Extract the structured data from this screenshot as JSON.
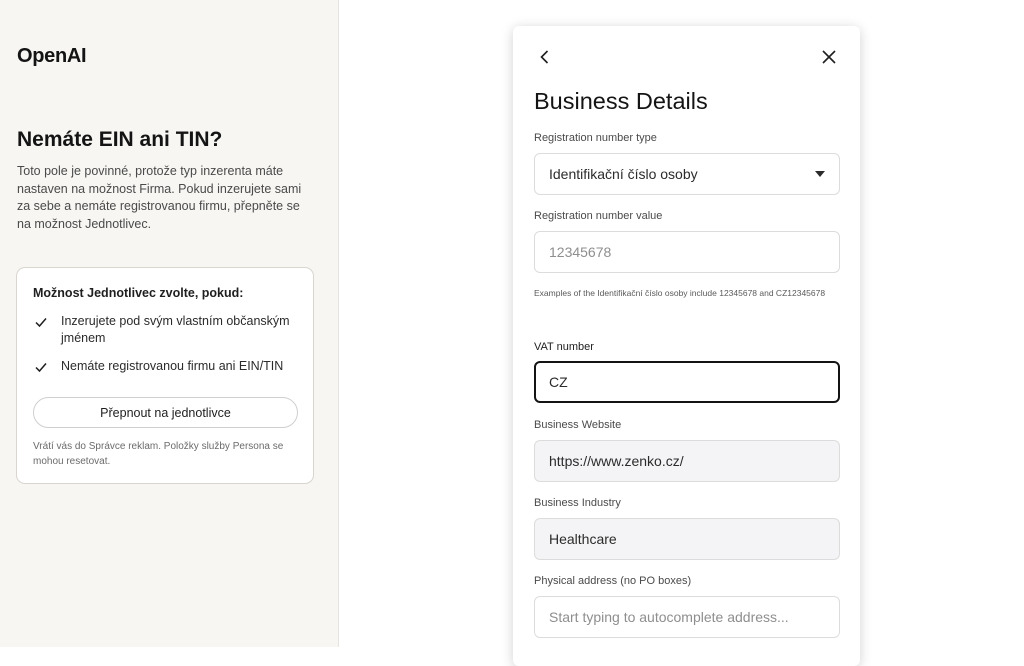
{
  "brand": {
    "logo": "OpenAI"
  },
  "info": {
    "heading": "Nemáte EIN ani TIN?",
    "description": "Toto pole je povinné, protože typ inzerenta máte nastaven na možnost Firma. Pokud inzerujete sami za sebe a nemáte registrovanou firmu, přepněte se na možnost Jednotlivec.",
    "card": {
      "title": "Možnost Jednotlivec zvolte, pokud:",
      "bullets": [
        "Inzerujete pod svým vlastním občanským jménem",
        "Nemáte registrovanou firmu ani EIN/TIN"
      ],
      "button_label": "Přepnout na jednotlivce",
      "note": "Vrátí vás do Správce reklam. Položky služby Persona se mohou resetovat."
    }
  },
  "form": {
    "title": "Business Details",
    "reg_type": {
      "label": "Registration number type",
      "value": "Identifikační číslo osoby"
    },
    "reg_value": {
      "label": "Registration number value",
      "placeholder": "12345678",
      "value": ""
    },
    "helper": "Examples of the Identifikační číslo osoby include 12345678 and CZ12345678",
    "vat": {
      "label": "VAT number",
      "value": "CZ"
    },
    "website": {
      "label": "Business Website",
      "value": "https://www.zenko.cz/"
    },
    "industry": {
      "label": "Business Industry",
      "value": "Healthcare"
    },
    "address": {
      "label": "Physical address (no PO boxes)",
      "placeholder": "Start typing to autocomplete address...",
      "value": ""
    }
  },
  "icons": {
    "back": "chevron-left-icon",
    "close": "close-icon",
    "check": "checkmark-icon",
    "caret": "caret-down-icon"
  }
}
